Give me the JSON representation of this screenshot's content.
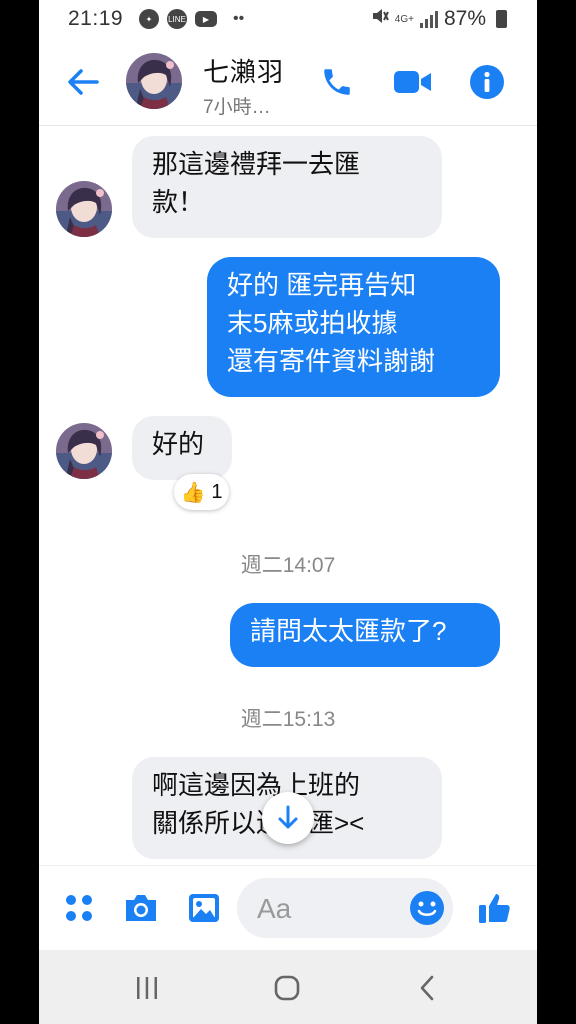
{
  "status_bar": {
    "time": "21:19",
    "network": "4G+",
    "battery": "87%"
  },
  "header": {
    "name": "七瀨羽",
    "status": "7小時…"
  },
  "messages": [
    {
      "dir": "in",
      "lines": [
        "那這邊禮拜一去匯",
        "款！"
      ]
    },
    {
      "dir": "out",
      "lines": [
        "好的 匯完再告知",
        "末5麻或拍收據",
        "還有寄件資料謝謝"
      ]
    },
    {
      "dir": "in",
      "lines": [
        "好的"
      ],
      "reaction": {
        "emoji": "👍",
        "count": "1"
      }
    },
    {
      "dir": "out",
      "lines": [
        "請問太太匯款了?"
      ]
    },
    {
      "dir": "in",
      "lines": [
        "啊這邊因為上班的",
        "關係所以還沒匯><"
      ]
    }
  ],
  "timestamps": [
    "週二14:07",
    "週二15:13"
  ],
  "composer": {
    "placeholder": "Aa"
  },
  "colors": {
    "accent": "#1a80f4",
    "incoming_bubble": "#eeeff2"
  },
  "icons": {
    "header": [
      "back-arrow-icon",
      "phone-icon",
      "video-camera-icon",
      "info-icon"
    ],
    "composer": [
      "apps-grid-icon",
      "camera-icon",
      "image-icon",
      "emoji-icon",
      "thumbs-up-icon"
    ],
    "nav": [
      "recent-apps-icon",
      "home-icon",
      "back-icon"
    ]
  }
}
